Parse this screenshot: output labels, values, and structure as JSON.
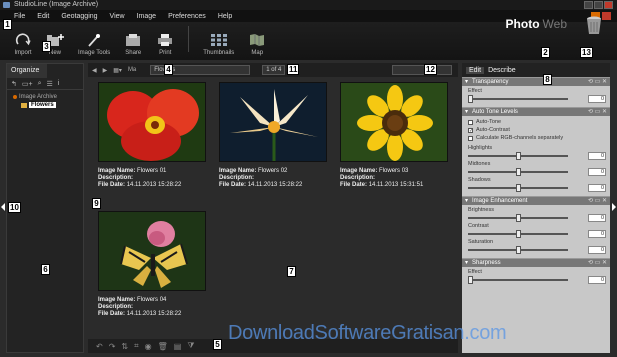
{
  "window": {
    "title": "StudioLine (Image Archive)"
  },
  "menu": {
    "items": [
      "File",
      "Edit",
      "Geotagging",
      "View",
      "Image",
      "Preferences",
      "Help"
    ]
  },
  "toolbar": {
    "buttons": [
      "Import",
      "New",
      "Image Tools",
      "Share",
      "Print",
      "Thumbnails",
      "Map"
    ],
    "mode_photo": "Photo",
    "mode_web": "Web"
  },
  "markers": [
    "1",
    "2",
    "3",
    "4",
    "5",
    "6",
    "7",
    "8",
    "9",
    "10",
    "11",
    "12",
    "13"
  ],
  "left_panel": {
    "tab": "Organize",
    "tree_root": "Image Archive",
    "tree_child": "Flowers"
  },
  "center": {
    "nav_label": "Ma",
    "path": "Flowers",
    "counter": "1 of 4"
  },
  "images": [
    {
      "name_label": "Image Name:",
      "name": "Flowers 01",
      "desc_label": "Description:",
      "date_label": "File Date:",
      "date": "14.11.2013 15:28:22"
    },
    {
      "name_label": "Image Name:",
      "name": "Flowers 02",
      "desc_label": "Description:",
      "date_label": "File Date:",
      "date": "14.11.2013 15:28:22"
    },
    {
      "name_label": "Image Name:",
      "name": "Flowers 03",
      "desc_label": "Description:",
      "date_label": "File Date:",
      "date": "14.11.2013 15:31:51"
    },
    {
      "name_label": "Image Name:",
      "name": "Flowers 04",
      "desc_label": "Description:",
      "date_label": "File Date:",
      "date": "14.11.2013 15:28:22"
    }
  ],
  "right_panel": {
    "tabs": [
      "Edit",
      "Describe"
    ],
    "sections": {
      "transparency": {
        "title": "Transparency",
        "effect_label": "Effect",
        "effect_value": "0"
      },
      "auto_tone": {
        "title": "Auto Tone Levels",
        "auto_tone": "Auto-Tone",
        "auto_contrast": "Auto-Contrast",
        "rgb_sep": "Calculate RGB-channels separately",
        "highlights_label": "Highlights",
        "highlights_value": "0",
        "midtones_label": "Midtones",
        "midtones_value": "0",
        "shadows_label": "Shadows",
        "shadows_value": "0"
      },
      "enhancement": {
        "title": "Image Enhancement",
        "brightness_label": "Brightness",
        "brightness_value": "0",
        "contrast_label": "Contrast",
        "contrast_value": "0",
        "saturation_label": "Saturation",
        "saturation_value": "0"
      },
      "sharpness": {
        "title": "Sharpness",
        "effect_label": "Effect",
        "effect_value": "0"
      }
    }
  },
  "watermark": "DownloadSoftwareGratisan.com",
  "colors": {
    "accent": "#d96a00",
    "panel_light": "#c8c8c8",
    "bg_dark": "#2b2b2b",
    "watermark": "#5a96e6"
  }
}
